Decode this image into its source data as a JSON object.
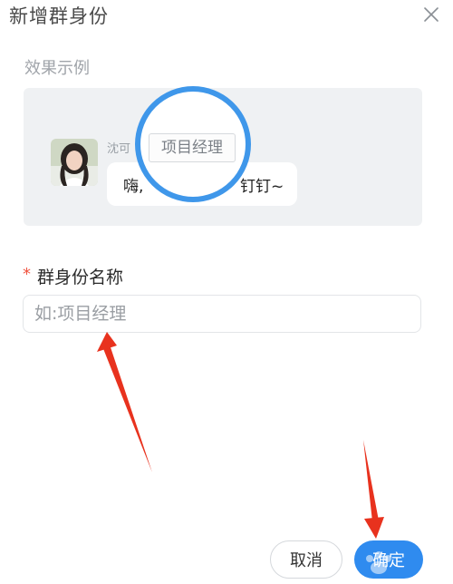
{
  "dialog": {
    "title": "新增群身份",
    "close_icon": "close-icon"
  },
  "preview": {
    "section_label": "效果示例",
    "sender_name": "沈可",
    "message_start": "嗨,",
    "message_end": "钉钉~",
    "role_tag": "项目经理",
    "avatar_icon": "user-avatar-photo"
  },
  "form": {
    "required_mark": "*",
    "name_label": "群身份名称",
    "name_placeholder": "如:项目经理",
    "name_value": ""
  },
  "footer": {
    "cancel_label": "取消",
    "confirm_label": "确定"
  },
  "colors": {
    "accent": "#2f8bef",
    "magnifier_ring": "#3f97ea",
    "required": "#f0533f",
    "annotation_arrow": "#e8321e"
  }
}
